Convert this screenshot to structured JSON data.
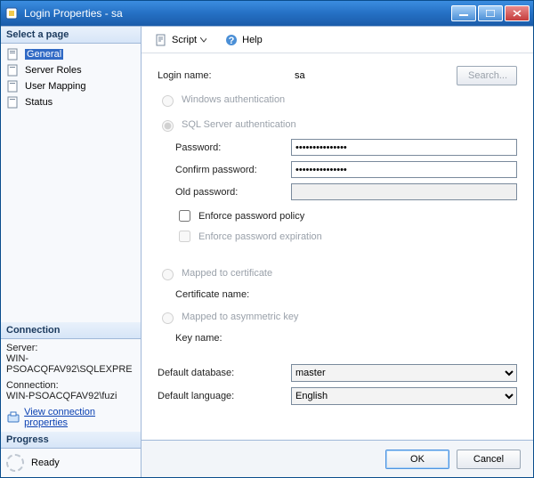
{
  "window": {
    "title": "Login Properties - sa"
  },
  "sidebar": {
    "select_page_label": "Select a page",
    "pages": [
      {
        "label": "General"
      },
      {
        "label": "Server Roles"
      },
      {
        "label": "User Mapping"
      },
      {
        "label": "Status"
      }
    ],
    "connection": {
      "header": "Connection",
      "server_label": "Server:",
      "server_value": "WIN-PSOACQFAV92\\SQLEXPRE",
      "connection_label": "Connection:",
      "connection_value": "WIN-PSOACQFAV92\\fuzi",
      "view_props": "View connection properties"
    },
    "progress": {
      "header": "Progress",
      "status": "Ready"
    }
  },
  "toolbar": {
    "script_label": "Script",
    "help_label": "Help"
  },
  "form": {
    "login_name_label": "Login name:",
    "login_name_value": "sa",
    "search_label": "Search...",
    "auth": {
      "windows_label": "Windows authentication",
      "sql_label": "SQL Server authentication",
      "password_label": "Password:",
      "password_value": "•••••••••••••••",
      "confirm_label": "Confirm password:",
      "confirm_value": "•••••••••••••••",
      "old_label": "Old password:",
      "old_value": "",
      "enforce_policy_label": "Enforce password policy",
      "enforce_expiration_label": "Enforce password expiration"
    },
    "mapped_cert_label": "Mapped to certificate",
    "cert_name_label": "Certificate name:",
    "mapped_asym_label": "Mapped to asymmetric key",
    "key_name_label": "Key name:",
    "default_db_label": "Default database:",
    "default_db_value": "master",
    "default_lang_label": "Default language:",
    "default_lang_value": "English"
  },
  "buttons": {
    "ok": "OK",
    "cancel": "Cancel"
  }
}
